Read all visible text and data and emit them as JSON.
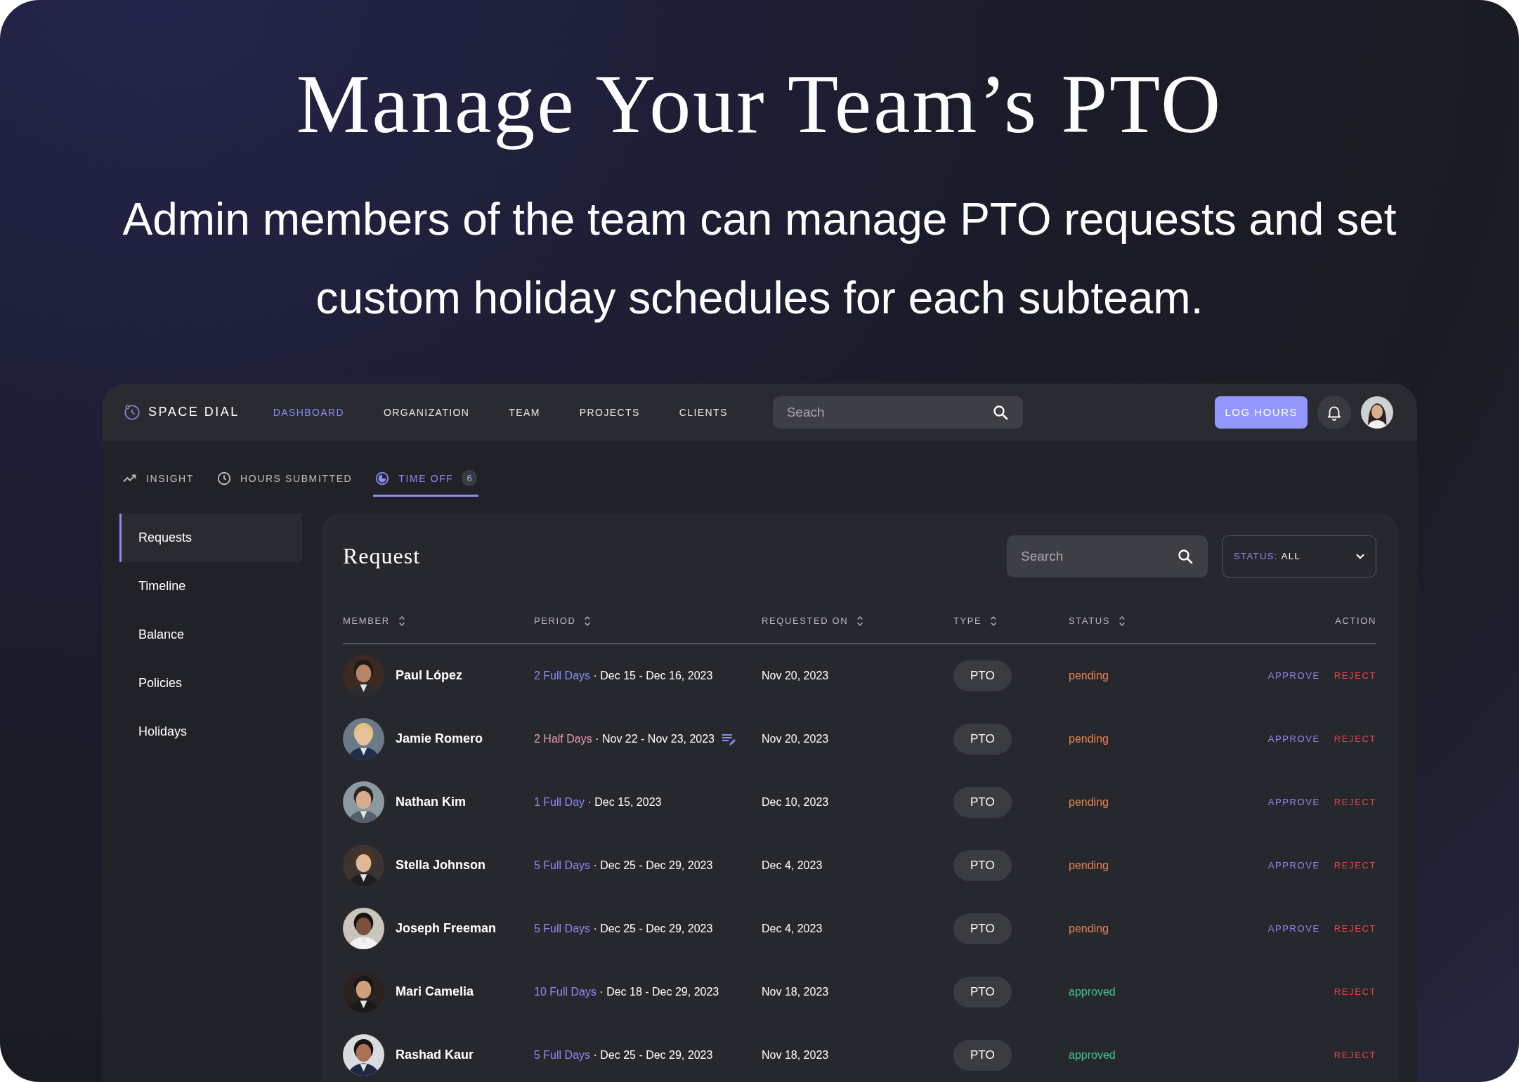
{
  "headline": "Manage Your Team’s PTO",
  "subtitle": "Admin members of the team can manage PTO requests and set custom holiday schedules for each subteam.",
  "app": {
    "brand": "SPACE DIAL",
    "nav": [
      {
        "label": "DASHBOARD",
        "selected": true
      },
      {
        "label": "ORGANIZATION",
        "selected": false
      },
      {
        "label": "TEAM",
        "selected": false
      },
      {
        "label": "PROJECTS",
        "selected": false
      },
      {
        "label": "CLIENTS",
        "selected": false
      }
    ],
    "search": {
      "placeholder": "Seach"
    },
    "log_hours": "LOG HOURS",
    "tabs": [
      {
        "label": "INSIGHT",
        "kind": "trend",
        "selected": false
      },
      {
        "label": "HOURS SUBMITTED",
        "kind": "clock",
        "selected": false
      },
      {
        "label": "TIME OFF",
        "kind": "timeoff",
        "selected": true,
        "badge": "6"
      }
    ],
    "sidebar": {
      "items": [
        {
          "label": "Requests",
          "selected": true
        },
        {
          "label": "Timeline",
          "selected": false
        },
        {
          "label": "Balance",
          "selected": false
        },
        {
          "label": "Policies",
          "selected": false
        },
        {
          "label": "Holidays",
          "selected": false
        }
      ]
    },
    "request": {
      "title": "Request",
      "search": {
        "placeholder": "Search"
      },
      "status_filter": {
        "label": "STATUS:",
        "value": "ALL"
      },
      "table": {
        "columns": [
          {
            "label": "MEMBER",
            "sortable": true
          },
          {
            "label": "PERIOD",
            "sortable": true
          },
          {
            "label": "REQUESTED ON",
            "sortable": true
          },
          {
            "label": "TYPE",
            "sortable": true
          },
          {
            "label": "STATUS",
            "sortable": true
          },
          {
            "label": "ACTION",
            "sortable": false
          }
        ],
        "rows": [
          {
            "member": "Paul López",
            "period_amount": "2 Full Days",
            "color": "#8b8cf2",
            "period_dates": "· Dec 15 - Dec 16, 2023",
            "has_note": false,
            "requested_on": "Nov 20, 2023",
            "type": "PTO",
            "status": {
              "text": "pending",
              "color": "#e8834f"
            },
            "actions": [
              {
                "kind": "approve",
                "label": "APPROVE"
              },
              {
                "kind": "reject",
                "label": "REJECT"
              }
            ]
          },
          {
            "member": "Jamie Romero",
            "period_amount": "2 Half Days",
            "color": "#e79bb5",
            "period_dates": "· Nov 22 - Nov 23, 2023",
            "has_note": true,
            "requested_on": "Nov 20, 2023",
            "type": "PTO",
            "status": {
              "text": "pending",
              "color": "#e8834f"
            },
            "actions": [
              {
                "kind": "approve",
                "label": "APPROVE"
              },
              {
                "kind": "reject",
                "label": "REJECT"
              }
            ]
          },
          {
            "member": "Nathan Kim",
            "period_amount": "1 Full Day",
            "color": "#8b8cf2",
            "period_dates": "· Dec 15, 2023",
            "has_note": false,
            "requested_on": "Dec 10, 2023",
            "type": "PTO",
            "status": {
              "text": "pending",
              "color": "#e8834f"
            },
            "actions": [
              {
                "kind": "approve",
                "label": "APPROVE"
              },
              {
                "kind": "reject",
                "label": "REJECT"
              }
            ]
          },
          {
            "member": "Stella Johnson",
            "period_amount": "5 Full Days",
            "color": "#8b8cf2",
            "period_dates": "· Dec 25 - Dec 29, 2023",
            "has_note": false,
            "requested_on": "Dec 4, 2023",
            "type": "PTO",
            "status": {
              "text": "pending",
              "color": "#e8834f"
            },
            "actions": [
              {
                "kind": "approve",
                "label": "APPROVE"
              },
              {
                "kind": "reject",
                "label": "REJECT"
              }
            ]
          },
          {
            "member": "Joseph Freeman",
            "period_amount": "5 Full Days",
            "color": "#8b8cf2",
            "period_dates": "· Dec 25 - Dec 29, 2023",
            "has_note": false,
            "requested_on": "Dec 4, 2023",
            "type": "PTO",
            "status": {
              "text": "pending",
              "color": "#e8834f"
            },
            "actions": [
              {
                "kind": "approve",
                "label": "APPROVE"
              },
              {
                "kind": "reject",
                "label": "REJECT"
              }
            ]
          },
          {
            "member": "Mari Camelia",
            "period_amount": "10 Full Days",
            "color": "#8b8cf2",
            "period_dates": "· Dec 18 - Dec 29, 2023",
            "has_note": false,
            "requested_on": "Nov 18, 2023",
            "type": "PTO",
            "status": {
              "text": "approved",
              "color": "#3fc49a"
            },
            "actions": [
              {
                "kind": "reject",
                "label": "REJECT"
              }
            ]
          },
          {
            "member": "Rashad Kaur",
            "period_amount": "5 Full Days",
            "color": "#8b8cf2",
            "period_dates": "· Dec 25 - Dec 29, 2023",
            "has_note": false,
            "requested_on": "Nov 18, 2023",
            "type": "PTO",
            "status": {
              "text": "approved",
              "color": "#3fc49a"
            },
            "actions": [
              {
                "kind": "reject",
                "label": "REJECT"
              }
            ]
          }
        ]
      }
    }
  }
}
